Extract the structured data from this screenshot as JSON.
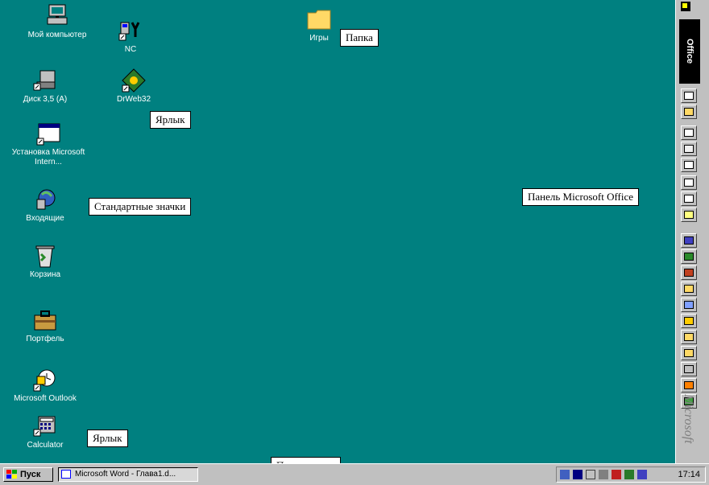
{
  "desktop": {
    "icons": [
      {
        "label": "Мой компьютер"
      },
      {
        "label": "NC"
      },
      {
        "label": "Игры"
      },
      {
        "label": "Диск 3,5 (A)"
      },
      {
        "label": "DrWeb32"
      },
      {
        "label": "Установка Microsoft Intern..."
      },
      {
        "label": "Входящие"
      },
      {
        "label": "Корзина"
      },
      {
        "label": "Портфель"
      },
      {
        "label": "Microsoft Outlook"
      },
      {
        "label": "Calculator"
      }
    ],
    "callouts": {
      "folder": "Папка",
      "shortcut_top": "Ярлык",
      "standard_icons": "Стандартные значки",
      "office_panel": "Панель Microsoft Office",
      "shortcut_bottom": "Ярлык",
      "taskbar": "Панель задач"
    }
  },
  "office_bar": {
    "title": "Office",
    "brand_text": "Microsoft"
  },
  "taskbar": {
    "start_label": "Пуск",
    "task_label": "Microsoft Word - Глава1.d...",
    "clock": "17:14"
  },
  "colors": {
    "desktop": "#008080",
    "chrome": "#c0c0c0"
  }
}
